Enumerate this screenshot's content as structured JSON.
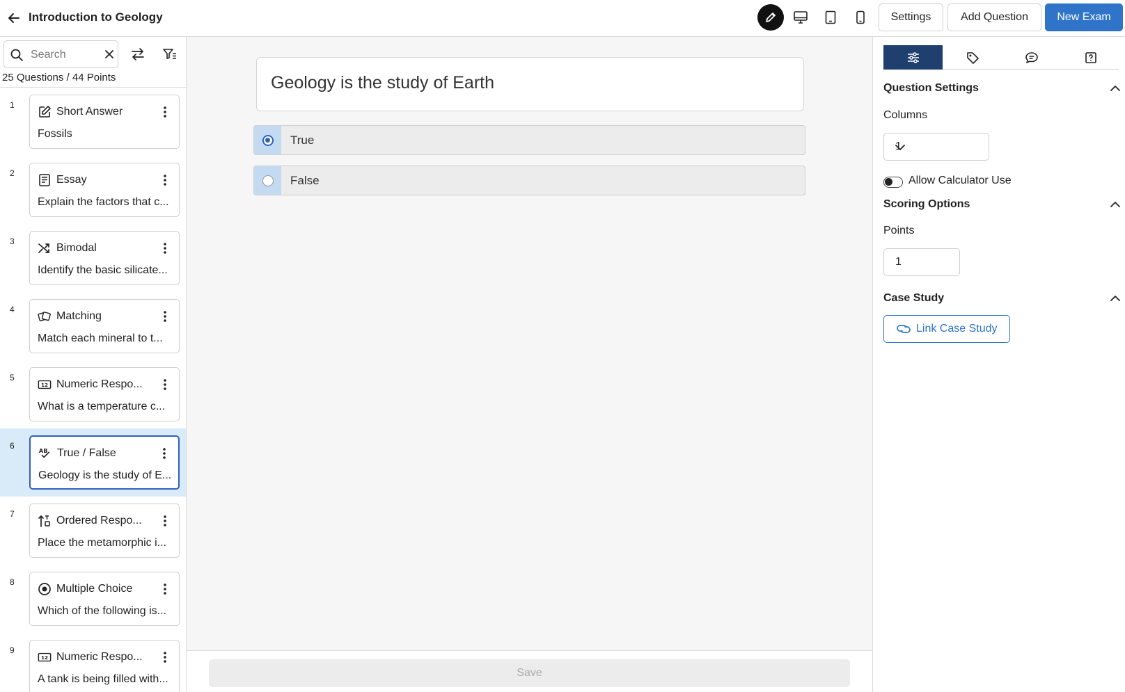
{
  "header": {
    "title": "Introduction to Geology",
    "settings_label": "Settings",
    "add_question_label": "Add Question",
    "new_exam_label": "New Exam"
  },
  "sidebar": {
    "search_placeholder": "Search",
    "summary": "25 Questions / 44 Points",
    "questions": [
      {
        "num": "1",
        "type": "Short Answer",
        "icon": "edit-icon",
        "text": "Fossils"
      },
      {
        "num": "2",
        "type": "Essay",
        "icon": "document-icon",
        "text": "Explain the factors that c..."
      },
      {
        "num": "3",
        "type": "Bimodal",
        "icon": "shuffle-icon",
        "text": "Identify the basic silicate..."
      },
      {
        "num": "4",
        "type": "Matching",
        "icon": "matching-icon",
        "text": "Match each mineral to t..."
      },
      {
        "num": "5",
        "type": "Numeric Respo...",
        "icon": "numeric-icon",
        "text": "What is a temperature c..."
      },
      {
        "num": "6",
        "type": "True / False",
        "icon": "spellcheck-icon",
        "text": "Geology is the study of E...",
        "selected": true
      },
      {
        "num": "7",
        "type": "Ordered Respo...",
        "icon": "ordered-icon",
        "text": "Place the metamorphic i..."
      },
      {
        "num": "8",
        "type": "Multiple Choice",
        "icon": "radio-icon",
        "text": "Which of the following is..."
      },
      {
        "num": "9",
        "type": "Numeric Respo...",
        "icon": "numeric-icon",
        "text": "A tank is being filled with..."
      }
    ]
  },
  "main": {
    "question_text": "Geology is the study of Earth",
    "options": [
      {
        "label": "True",
        "checked": true
      },
      {
        "label": "False",
        "checked": false
      }
    ],
    "save_label": "Save"
  },
  "panel": {
    "question_settings_title": "Question Settings",
    "columns_label": "Columns",
    "columns_value": "1",
    "calculator_label": "Allow Calculator Use",
    "calculator_enabled": false,
    "scoring_title": "Scoring Options",
    "points_label": "Points",
    "points_value": "1",
    "case_study_title": "Case Study",
    "link_case_study_label": "Link Case Study"
  },
  "colors": {
    "accent": "#2f74c8",
    "selected_row": "#d9ebf8",
    "panel_tab_active": "#1f3f6e"
  }
}
